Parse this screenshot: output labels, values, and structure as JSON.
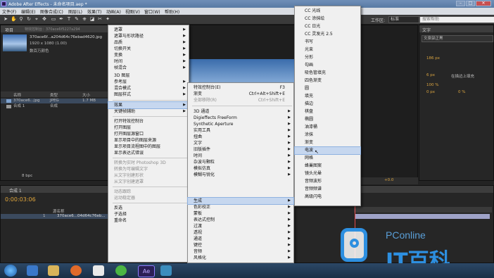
{
  "window": {
    "title": "Adobe After Effects - 未命名项目.aep *",
    "min": "–",
    "max": "□",
    "close": "✕"
  },
  "menubar": [
    "文件(F)",
    "编辑(E)",
    "图像合成(C)",
    "图层(L)",
    "效果(T)",
    "动画(A)",
    "视图(V)",
    "窗口(W)",
    "帮助(H)"
  ],
  "workspace": {
    "label": "工作区:",
    "value": "标准",
    "search": "搜索帮助"
  },
  "project_panel": {
    "tab": "项目",
    "tab2": "特效控制台：370ace6f5227a294",
    "item_name": "370ace6f...a204d64c76ebad4620.jpg",
    "item_info": "1920 x 1080 (1.00)",
    "item_color": "数百万颜色",
    "columns": [
      "名称",
      "类型",
      "大小"
    ],
    "rows": [
      {
        "name": "370ace6...jpg",
        "type": "JPEG",
        "size": "1.7 MB"
      },
      {
        "name": "合成 1",
        "type": "合成",
        "size": ""
      }
    ],
    "bpc": "8 bpc"
  },
  "timeline": {
    "tab": "合成 1",
    "timecode": "0:00:03:06",
    "col": "源名称",
    "layer_num": "1",
    "layer_name": "370ace6...04d64c76eb..."
  },
  "right_panel": {
    "tab": "文字",
    "font": "文泉驿正黑",
    "size": "186 px",
    "stroke": "6 px",
    "stroke_mode": "在描边上填充",
    "pct1": "100 %",
    "pct2": "0 %",
    "zero": "0 px"
  },
  "comp_bottom": {
    "zoom": "+0.0"
  },
  "context_menu": {
    "items": [
      {
        "label": "遮罩",
        "arrow": true
      },
      {
        "label": "遮罩与形状路径",
        "arrow": true
      },
      {
        "label": "品质",
        "arrow": true
      },
      {
        "label": "切换开关",
        "arrow": true
      },
      {
        "label": "变换",
        "arrow": true
      },
      {
        "label": "时间",
        "arrow": true
      },
      {
        "label": "帧混合",
        "arrow": true
      },
      {
        "label": "3D 图层",
        "arrow": false
      },
      {
        "label": "参考层",
        "arrow": true
      },
      {
        "label": "混合模式",
        "arrow": true
      },
      {
        "label": "图层样式",
        "arrow": true
      },
      {
        "label": "效果",
        "arrow": true,
        "highlight": true
      },
      {
        "label": "关键帧辅助",
        "arrow": true
      },
      {
        "label": "打开特效控制台"
      },
      {
        "label": "打开图层"
      },
      {
        "label": "打开图层源窗口"
      },
      {
        "label": "显示项目中的图层来源"
      },
      {
        "label": "显示项目流程图中的图层"
      },
      {
        "label": "显示表达式错误"
      },
      {
        "label": "转换为实时 Photoshop 3D",
        "disabled": true
      },
      {
        "label": "转换为可编辑文字",
        "disabled": true
      },
      {
        "label": "从文字创建形状",
        "disabled": true
      },
      {
        "label": "从文字创建遮罩",
        "disabled": true
      },
      {
        "label": "动态跟踪",
        "disabled": true
      },
      {
        "label": "运动稳定器",
        "disabled": true
      },
      {
        "label": "反选"
      },
      {
        "label": "子选择"
      },
      {
        "label": "重命名"
      }
    ]
  },
  "effects_menu": {
    "items": [
      {
        "label": "特效控制台(E)",
        "shortcut": "F3"
      },
      {
        "label": "渐变",
        "shortcut": "Ctrl+Alt+Shift+E"
      },
      {
        "label": "全部移除(R)",
        "shortcut": "Ctrl+Shift+E",
        "disabled": true
      },
      {
        "label": "3D 通道",
        "arrow": true
      },
      {
        "label": "Digieffects FreeForm",
        "arrow": true
      },
      {
        "label": "Synthetic Aperture",
        "arrow": true
      },
      {
        "label": "实用工具",
        "arrow": true
      },
      {
        "label": "扭曲",
        "arrow": true
      },
      {
        "label": "文字",
        "arrow": true
      },
      {
        "label": "旧版插件",
        "arrow": true
      },
      {
        "label": "时间",
        "arrow": true
      },
      {
        "label": "杂波与颗粒",
        "arrow": true
      },
      {
        "label": "模拟仿真",
        "arrow": true
      },
      {
        "label": "模糊与锐化",
        "arrow": true
      },
      {
        "label": "生成",
        "arrow": true,
        "highlight": true
      },
      {
        "label": "色彩校正",
        "arrow": true
      },
      {
        "label": "蒙板",
        "arrow": true
      },
      {
        "label": "表达式控制",
        "arrow": true
      },
      {
        "label": "过渡",
        "arrow": true
      },
      {
        "label": "透视",
        "arrow": true
      },
      {
        "label": "通道",
        "arrow": true
      },
      {
        "label": "键控",
        "arrow": true
      },
      {
        "label": "音频",
        "arrow": true
      },
      {
        "label": "风格化",
        "arrow": true
      }
    ]
  },
  "generate_menu": {
    "items": [
      {
        "label": "CC 光线"
      },
      {
        "label": "CC 涂抹绘"
      },
      {
        "label": "CC 日光"
      },
      {
        "label": "CC 灵发光 2.5"
      },
      {
        "label": "书写"
      },
      {
        "label": "光束"
      },
      {
        "label": "分形"
      },
      {
        "label": "勾画"
      },
      {
        "label": "吸色管填充"
      },
      {
        "label": "四色渐变"
      },
      {
        "label": "圆"
      },
      {
        "label": "填充"
      },
      {
        "label": "描边"
      },
      {
        "label": "棋盘"
      },
      {
        "label": "椭圆"
      },
      {
        "label": "油漆桶"
      },
      {
        "label": "涂抹"
      },
      {
        "label": "渐变"
      },
      {
        "label": "电波",
        "highlight": true
      },
      {
        "label": "网格"
      },
      {
        "label": "蜂巢图案"
      },
      {
        "label": "镜头光晕"
      },
      {
        "label": "音频波形"
      },
      {
        "label": "音频频谱"
      },
      {
        "label": "高级闪电"
      }
    ]
  },
  "watermark": {
    "brand": "PConline",
    "sub": "IT百科"
  }
}
